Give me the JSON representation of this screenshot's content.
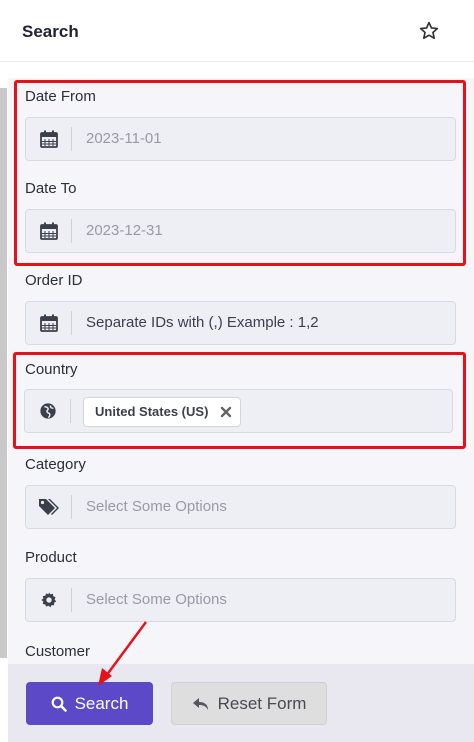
{
  "header": {
    "title": "Search",
    "star_icon": "star-outline-icon"
  },
  "fields": {
    "date_from": {
      "label": "Date From",
      "value": "2023-11-01",
      "icon": "calendar-icon"
    },
    "date_to": {
      "label": "Date To",
      "value": "2023-12-31",
      "icon": "calendar-icon"
    },
    "order_id": {
      "label": "Order ID",
      "placeholder": "Separate IDs with (,) Example : 1,2",
      "icon": "calendar-icon"
    },
    "country": {
      "label": "Country",
      "selected": "United States (US)",
      "icon": "globe-icon"
    },
    "category": {
      "label": "Category",
      "placeholder": "Select Some Options",
      "icon": "tags-icon"
    },
    "product": {
      "label": "Product",
      "placeholder": "Select Some Options",
      "icon": "gear-icon"
    },
    "customer": {
      "label": "Customer"
    }
  },
  "buttons": {
    "search": "Search",
    "reset": "Reset Form"
  },
  "colors": {
    "primary": "#5b49c8",
    "highlight": "#e8111a",
    "field_bg": "#eeeef5"
  }
}
